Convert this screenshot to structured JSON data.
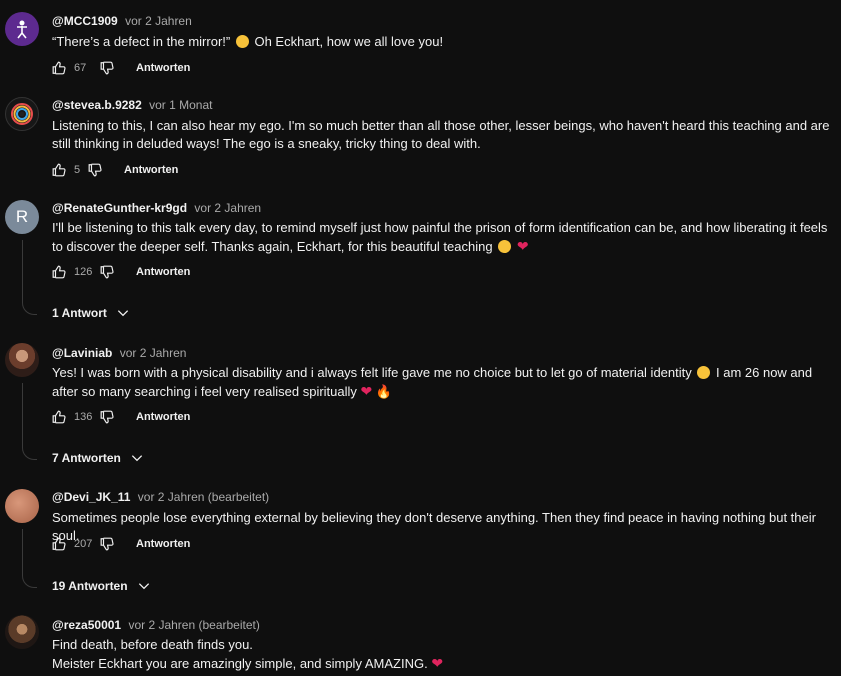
{
  "comments": [
    {
      "handle": "@MCC1909",
      "time": "vor 2 Jahren",
      "text_before": "“There’s a defect in the mirror!”",
      "text_after": "Oh Eckhart, how we all love you!",
      "likes": "67",
      "reply_label": "Antworten"
    },
    {
      "handle": "@stevea.b.9282",
      "time": "vor 1 Monat",
      "text": "Listening to this, I can also hear my ego. I'm so much better than all those other, lesser beings, who haven't heard this teaching and are still thinking in deluded ways! The ego is a sneaky, tricky thing to deal with.",
      "likes": "5",
      "reply_label": "Antworten"
    },
    {
      "handle": "@RenateGunther-kr9gd",
      "time": "vor 2 Jahren",
      "avatar_letter": "R",
      "text": "I'll be listening to this talk every day, to remind myself just how painful the prison of form identification can be, and how liberating it feels to discover the deeper self. Thanks again, Eckhart, for this beautiful teaching",
      "likes": "126",
      "reply_label": "Antworten",
      "replies_label": "1 Antwort"
    },
    {
      "handle": "@Laviniab",
      "time": "vor 2 Jahren",
      "text_before": "Yes! I was born with a physical disability and i always felt life gave me no choice but to let go of material identity",
      "text_after": "I am 26 now and after so many searching i feel very realised spiritually",
      "likes": "136",
      "reply_label": "Antworten",
      "replies_label": "7 Antworten"
    },
    {
      "handle": "@Devi_JK_11",
      "time": "vor 2 Jahren (bearbeitet)",
      "text": "Sometimes people lose everything external by believing they don't deserve anything. Then they find peace in having nothing but their soul.",
      "likes": "207",
      "reply_label": "Antworten",
      "replies_label": "19 Antworten"
    },
    {
      "handle": "@reza50001",
      "time": "vor 2 Jahren (bearbeitet)",
      "line1": "Find death, before death finds you.",
      "line2": "Meister Eckhart  you are amazingly  simple, and simply AMAZING."
    }
  ],
  "icons": {
    "like": "thumbs-up-icon",
    "dislike": "thumbs-down-icon",
    "expand": "chevron-down-icon",
    "heart": "red-heart-emoji",
    "smile": "grinning-face-emoji",
    "fire": "fire-emoji"
  },
  "colors": {
    "background": "#0f0f0f",
    "text": "#f1f1f1",
    "secondary_text": "#aaaaaa",
    "heart": "#e0245e"
  }
}
